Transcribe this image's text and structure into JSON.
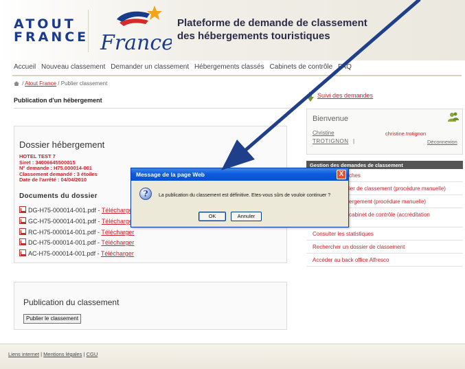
{
  "header": {
    "logo_line1": "ATOUT",
    "logo_line2": "FRANCE",
    "brand_script": "France",
    "title_line1": "Plateforme de demande de classement",
    "title_line2": "des hébergements touristiques"
  },
  "nav": {
    "items": [
      "Accueil",
      "Nouveau classement",
      "Demander un classement",
      "Hébergements classés",
      "Cabinets de contrôle",
      "FAQ"
    ]
  },
  "breadcrumb": {
    "sep1": "/",
    "link": "Atout France",
    "current": "/ Publier classement"
  },
  "page_title": "Publication d'un hébergement",
  "dossier": {
    "heading": "Dossier hébergement",
    "hotel_name": "HOTEL TEST 7",
    "siret": "Siret : 34006645500015",
    "demande": "N° demande : H75.000014-001",
    "classement": "Classement demandé : 3 étoiles",
    "date_arrete": "Date de l'arrêté : 04/04/2010",
    "documents_title": "Documents du dossier",
    "documents": [
      {
        "file": "DG-H75-000014-001.pdf -",
        "link": "Télécharger"
      },
      {
        "file": "GC-H75-000014-001.pdf -",
        "link": "Télécharger"
      },
      {
        "file": "RC-H75-000014-001.pdf -",
        "link": "Télécharger"
      },
      {
        "file": "DC-H75-000014-001.pdf -",
        "link": "Télécharger"
      },
      {
        "file": "AC-H75-000014-001.pdf -",
        "link": "Télécharger"
      }
    ]
  },
  "publication": {
    "heading": "Publication du classement",
    "button": "Publier le classement"
  },
  "sidebar": {
    "suivi": "Suivi des demandes",
    "bienvenue": "Bienvenue",
    "user_first": "Christine",
    "user_last": "TROTIGNON",
    "user_sep": "|",
    "user_email": "christine.trotignon",
    "logout": "Déconnexion",
    "gestion_header": "Gestion des demandes de classement",
    "menu": [
      "ches",
      "ier de classement (procédure manuelle)",
      "ergement (procédure manuelle)",
      "cabinet de contrôle (accréditation",
      "Consulter les statistiques",
      "Rechercher un dossier de classement",
      "Accéder au back office Alfresco"
    ]
  },
  "footer": {
    "links": [
      "Liens internet",
      "Mentions légales",
      "CGU"
    ],
    "sep": "|"
  },
  "dialog": {
    "title": "Message de la page Web",
    "close": "X",
    "icon": "question-icon",
    "message": "La publication du classement est définitive. Etes-vous sûrs de vouloir continuer ?",
    "ok": "OK",
    "cancel": "Annuler"
  },
  "colors": {
    "accent_red": "#c8232c",
    "brand_blue": "#1a3a8c",
    "arrow_blue": "#1f3f8a",
    "dialog_titlebar": "#0b5be0"
  }
}
